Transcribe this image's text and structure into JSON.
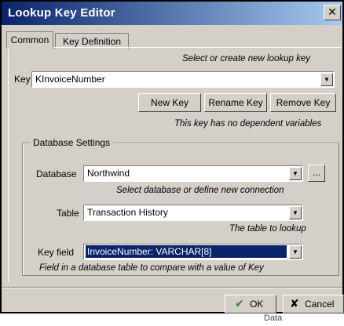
{
  "window": {
    "title": "Lookup Key Editor",
    "close_glyph": "✕"
  },
  "tabs": [
    {
      "label": "Common",
      "active": true
    },
    {
      "label": "Key Definition",
      "active": false
    }
  ],
  "key_section": {
    "hint_top": "Select or create new lookup key",
    "label": "Key",
    "value": "KInvoiceNumber",
    "buttons": {
      "new": "New Key",
      "rename": "Rename Key",
      "remove": "Remove Key"
    },
    "hint_dependent": "This key has no dependent variables"
  },
  "database_settings": {
    "group_title": "Database Settings",
    "database": {
      "label": "Database",
      "value": "Northwind",
      "hint": "Select database or define new connection",
      "browse": "..."
    },
    "table": {
      "label": "Table",
      "value": "Transaction History",
      "hint": "The table to lookup"
    },
    "key_field": {
      "label": "Key field",
      "value": "InvoiceNumber: VARCHAR[8]",
      "hint": "Field in a database table to compare with a value of Key"
    }
  },
  "footer": {
    "ok": "OK",
    "cancel": "Cancel"
  },
  "below_fragment": "Data",
  "colors": {
    "title_start": "#0a246a",
    "title_end": "#a6caf0",
    "face": "#d4d0c8",
    "selection": "#0a246a",
    "ok_check": "#2a8a2a"
  },
  "icons": {
    "ok": "check-icon",
    "cancel": "x-icon",
    "dropdown": "chevron-down-icon"
  }
}
